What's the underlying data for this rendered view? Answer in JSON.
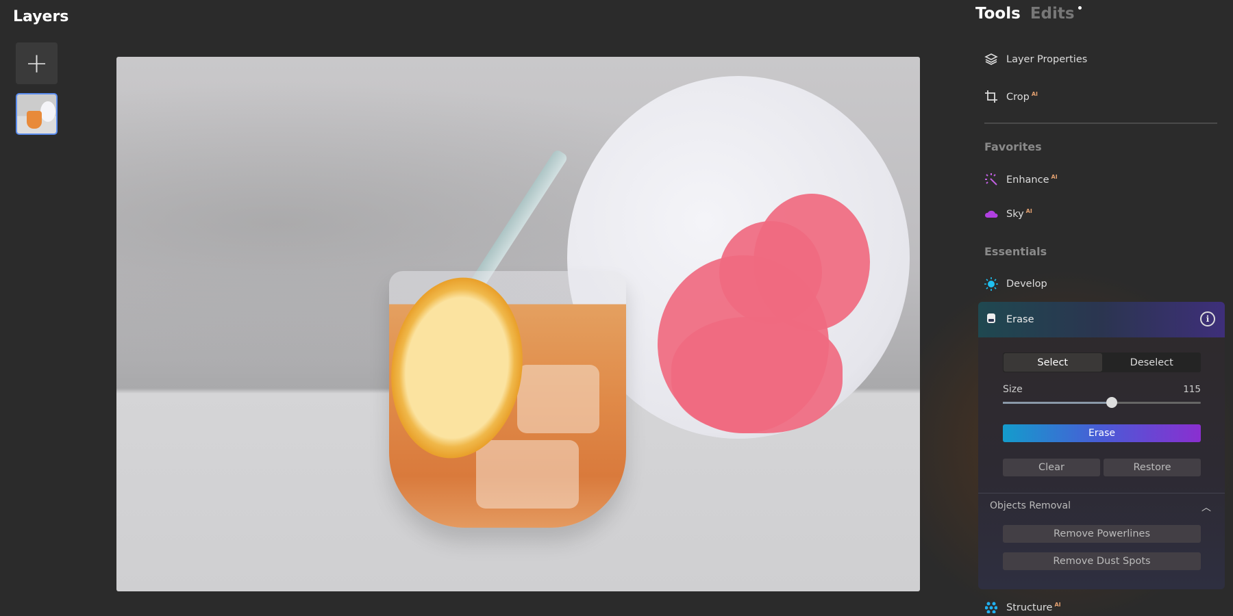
{
  "layers": {
    "title": "Layers",
    "add_icon": "plus-icon"
  },
  "panel": {
    "tabs": [
      {
        "label": "Tools",
        "active": true
      },
      {
        "label": "Edits",
        "active": false,
        "has_dot": true
      }
    ],
    "tools": [
      {
        "label": "Layer Properties",
        "icon": "layers-icon",
        "ai": ""
      },
      {
        "label": "Crop",
        "icon": "crop-icon",
        "ai": "AI"
      }
    ],
    "favorites_title": "Favorites",
    "favorites": [
      {
        "label": "Enhance",
        "icon": "magic-wand-icon",
        "ai": "AI"
      },
      {
        "label": "Sky",
        "icon": "cloud-icon",
        "ai": "AI"
      }
    ],
    "essentials_title": "Essentials",
    "develop": {
      "label": "Develop",
      "icon": "sun-icon"
    },
    "erase": {
      "title": "Erase",
      "select": "Select",
      "deselect": "Deselect",
      "size_label": "Size",
      "size_value": "115",
      "size_fraction": 0.55,
      "erase_button": "Erase",
      "clear": "Clear",
      "restore": "Restore",
      "objects_removal": "Objects Removal",
      "remove_powerlines": "Remove Powerlines",
      "remove_dust_spots": "Remove Dust Spots"
    },
    "structure": {
      "label": "Structure",
      "ai": "AI"
    }
  },
  "colors": {
    "accent_blue": "#149ccc",
    "accent_purple": "#8a2fd0",
    "mask": "#f06a80",
    "ai_badge": "#e2a070"
  }
}
